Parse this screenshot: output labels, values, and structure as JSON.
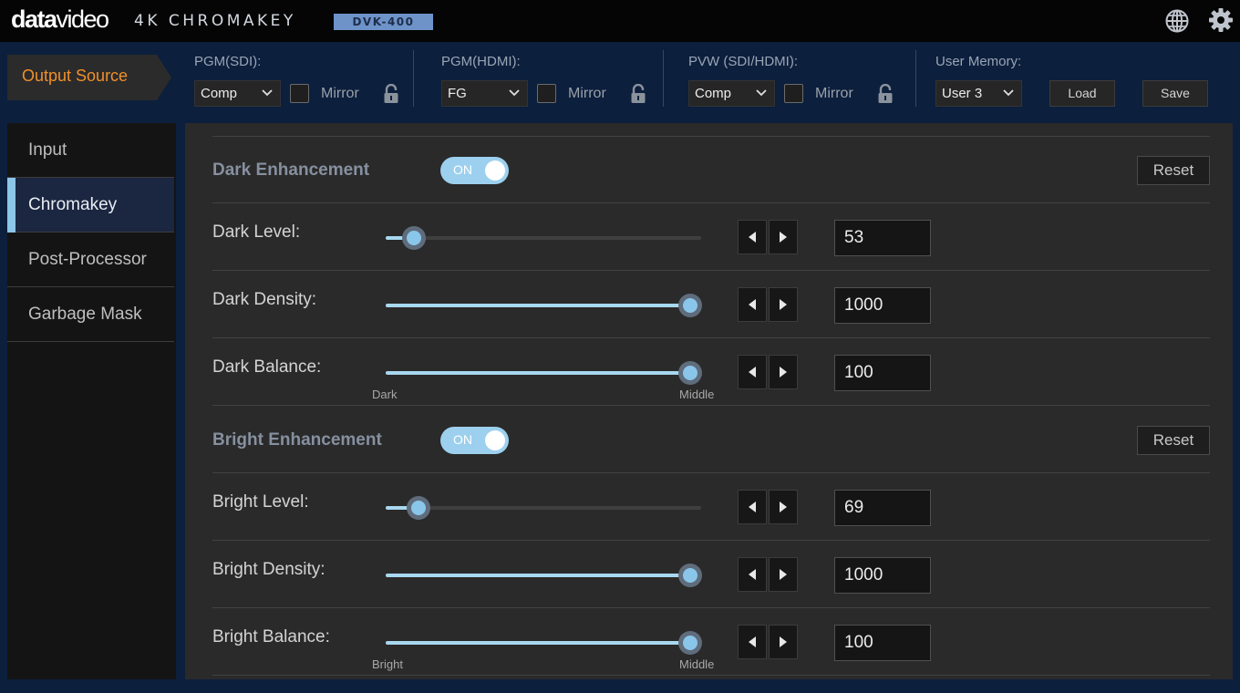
{
  "header": {
    "logo_bold": "data",
    "logo_light": "video",
    "product": "4K CHROMAKEY",
    "model": "DVK-400",
    "icons": [
      "globe-icon",
      "gear-icon"
    ]
  },
  "output_bar": {
    "title": "Output Source",
    "groups": [
      {
        "label": "PGM(SDI):",
        "value": "Comp",
        "mirror": "Mirror",
        "mirror_checked": false
      },
      {
        "label": "PGM(HDMI):",
        "value": "FG",
        "mirror": "Mirror",
        "mirror_checked": false
      },
      {
        "label": "PVW (SDI/HDMI):",
        "value": "Comp",
        "mirror": "Mirror",
        "mirror_checked": false
      }
    ],
    "memory": {
      "label": "User Memory:",
      "value": "User 3",
      "load": "Load",
      "save": "Save"
    }
  },
  "sidebar": {
    "items": [
      {
        "label": "Input",
        "active": false
      },
      {
        "label": "Chromakey",
        "active": true
      },
      {
        "label": "Post-Processor",
        "active": false
      },
      {
        "label": "Garbage Mask",
        "active": false
      }
    ]
  },
  "dark": {
    "title": "Dark Enhancement",
    "toggle": "ON",
    "reset": "Reset",
    "level": {
      "label": "Dark Level:",
      "value": "53",
      "fraction": 0.09
    },
    "density": {
      "label": "Dark Density:",
      "value": "1000",
      "fraction": 0.965
    },
    "balance": {
      "label": "Dark Balance:",
      "value": "100",
      "fraction": 0.965,
      "min_label": "Dark",
      "max_label": "Middle"
    }
  },
  "bright": {
    "title": "Bright Enhancement",
    "toggle": "ON",
    "reset": "Reset",
    "level": {
      "label": "Bright Level:",
      "value": "69",
      "fraction": 0.105
    },
    "density": {
      "label": "Bright Density:",
      "value": "1000",
      "fraction": 0.965
    },
    "balance": {
      "label": "Bright Balance:",
      "value": "100",
      "fraction": 0.965,
      "min_label": "Bright",
      "max_label": "Middle"
    }
  },
  "colors": {
    "accent": "#8ac6ea",
    "output_source": "#f0902a",
    "background": "#0c1f3d"
  }
}
